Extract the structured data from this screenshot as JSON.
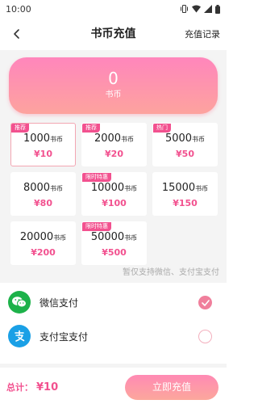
{
  "status_bar": {
    "time": "10:00"
  },
  "header": {
    "title": "书币充值",
    "right_link": "充值记录"
  },
  "balance": {
    "amount": "0",
    "unit": "书币"
  },
  "packages": [
    {
      "tag": "推荐",
      "coins": "1000",
      "unit": "书币",
      "price": "¥10",
      "selected": true
    },
    {
      "tag": "推荐",
      "coins": "2000",
      "unit": "书币",
      "price": "¥20",
      "selected": false
    },
    {
      "tag": "热门",
      "coins": "5000",
      "unit": "书币",
      "price": "¥50",
      "selected": false
    },
    {
      "tag": "",
      "coins": "8000",
      "unit": "书币",
      "price": "¥80",
      "selected": false
    },
    {
      "tag": "限时特惠",
      "coins": "10000",
      "unit": "书币",
      "price": "¥100",
      "selected": false
    },
    {
      "tag": "",
      "coins": "15000",
      "unit": "书币",
      "price": "¥150",
      "selected": false
    },
    {
      "tag": "",
      "coins": "20000",
      "unit": "书币",
      "price": "¥200",
      "selected": false
    },
    {
      "tag": "限时特惠",
      "coins": "50000",
      "unit": "书币",
      "price": "¥500",
      "selected": false
    }
  ],
  "hint": "暂仅支持微信、支付宝支付",
  "payment_methods": [
    {
      "label": "微信支付",
      "icon": "wechat-icon",
      "color": "#1db24a",
      "selected": true
    },
    {
      "label": "支付宝支付",
      "icon": "alipay-icon",
      "color": "#1aa0e6",
      "selected": false
    }
  ],
  "footer": {
    "total_label": "总计：",
    "total_value": "¥10",
    "button_label": "立即充值"
  },
  "colors": {
    "accent": "#f2518f",
    "gradient_start": "#ff86bc",
    "gradient_end": "#fda39e",
    "page_bg": "#f4f4f4"
  }
}
